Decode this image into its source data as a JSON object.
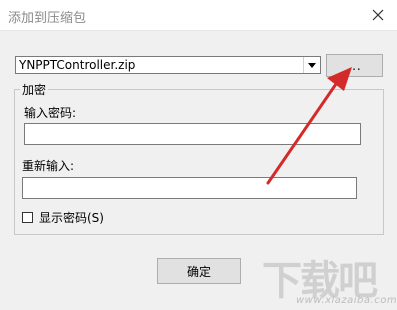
{
  "window": {
    "title": "添加到压缩包",
    "close_icon": "close-icon"
  },
  "archive": {
    "filename": "YNPPTController.zip",
    "browse_label": "..."
  },
  "encryption": {
    "legend": "加密",
    "password_label": "输入密码:",
    "password_value": "",
    "confirm_label": "重新输入:",
    "confirm_value": "",
    "show_password_label": "显示密码(S)",
    "show_password_checked": false
  },
  "actions": {
    "ok_label": "确定"
  },
  "annotation": {
    "arrow_color": "#d42a2a"
  },
  "watermark": {
    "text": "下载吧",
    "url": "www.xiazaiba.com"
  }
}
